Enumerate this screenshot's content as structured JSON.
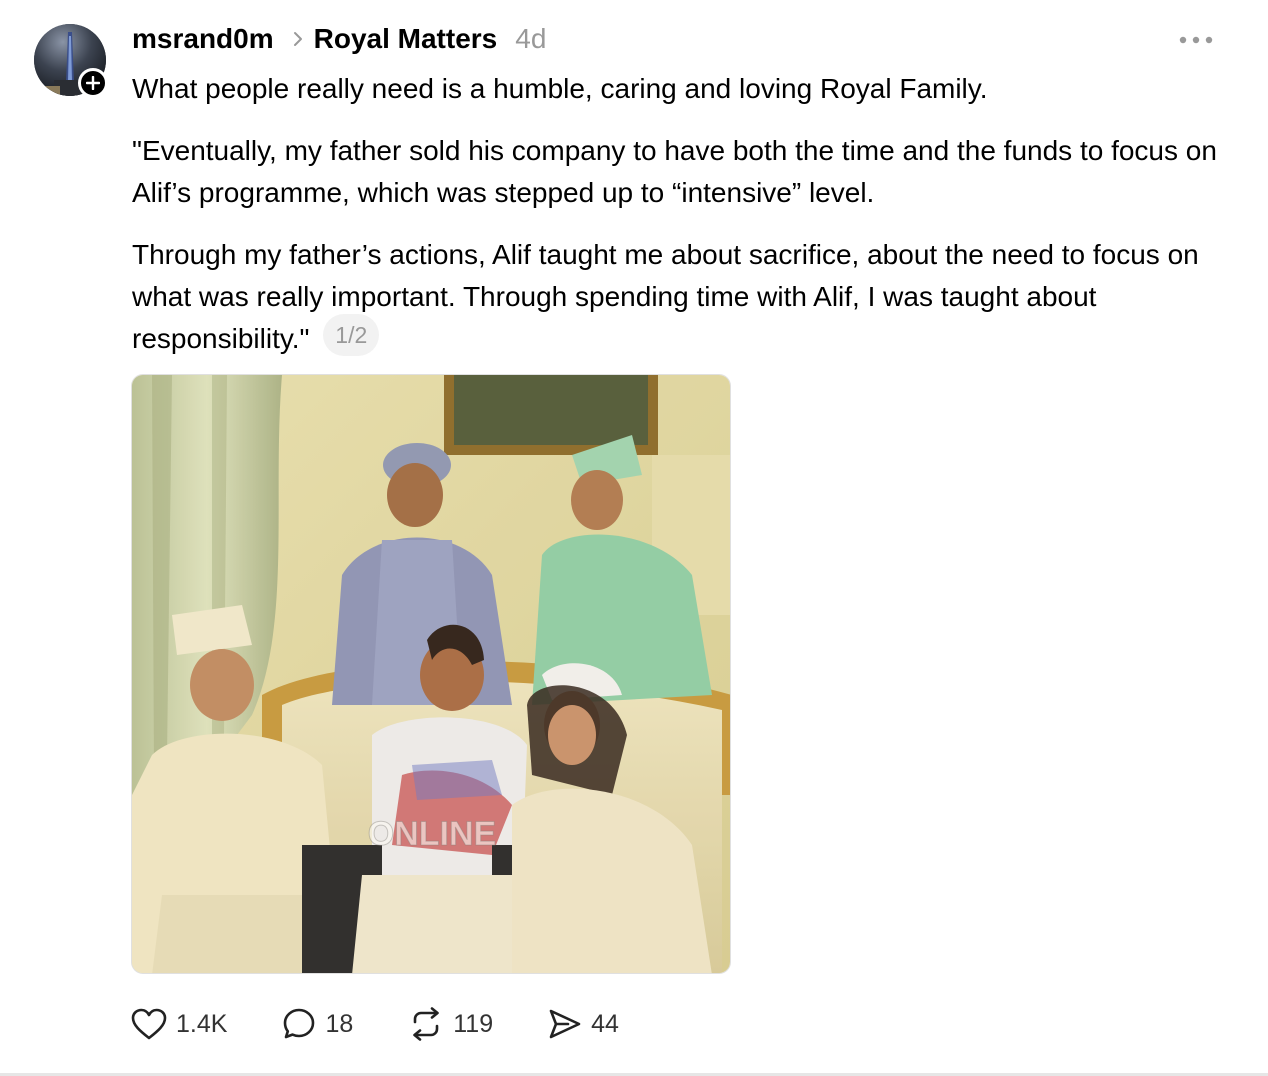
{
  "post": {
    "username": "msrand0m",
    "topic": "Royal Matters",
    "time_ago": "4d",
    "paragraphs": [
      "What people really need is a humble, caring and loving Royal Family.",
      "\"Eventually, my father sold his company to have both the time and the funds to focus on Alif’s programme, which was stepped up to “intensive” level.",
      "Through my father’s actions, Alif taught me about sacrifice, about the need to focus on what was really important. Through spending time with Alif, I was taught about responsibility.\""
    ],
    "page_counter": "1/2",
    "image_watermark": "ONLINE"
  },
  "actions": {
    "likes": "1.4K",
    "replies": "18",
    "reposts": "119",
    "shares": "44"
  },
  "icons": {
    "chevron": "chevron-right-icon",
    "more": "more-horizontal-icon",
    "follow": "plus-icon",
    "like": "heart-icon",
    "reply": "comment-icon",
    "repost": "repost-icon",
    "share": "send-icon"
  },
  "colors": {
    "text": "#000000",
    "muted": "#999999",
    "badge_bg": "#f2f2f2"
  }
}
